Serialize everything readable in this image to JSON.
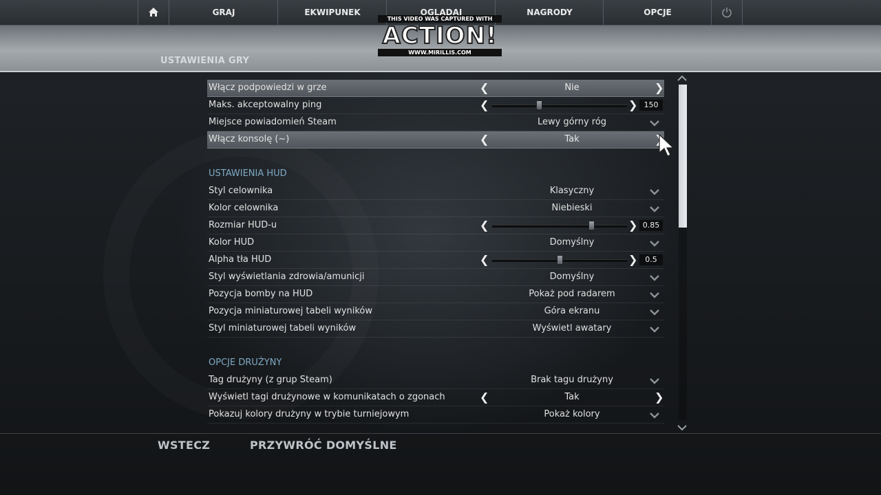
{
  "nav": {
    "items": [
      "GRAJ",
      "EKWIPUNEK",
      "OGLĄDAJ",
      "NAGRODY",
      "OPCJE"
    ]
  },
  "watermark": {
    "top": "THIS VIDEO WAS CAPTURED WITH",
    "main": "ACTION!",
    "bottom": "WWW.MIRILLIS.COM"
  },
  "header": {
    "title": "USTAWIENIA GRY"
  },
  "rows": [
    {
      "label": "Włącz podpowiedzi w grze",
      "type": "toggle",
      "value": "Nie",
      "highlight": true
    },
    {
      "label": "Maks. akceptowalny ping",
      "type": "slider",
      "value": "150",
      "level": 0.34
    },
    {
      "label": "Miejsce powiadomień Steam",
      "type": "dropdown",
      "value": "Lewy górny róg"
    },
    {
      "label": "Włącz konsolę (~)",
      "type": "toggle",
      "value": "Tak",
      "highlight": true
    }
  ],
  "hud": {
    "title": "USTAWIENIA HUD",
    "rows": [
      {
        "label": "Styl celownika",
        "type": "dropdown",
        "value": "Klasyczny"
      },
      {
        "label": "Kolor celownika",
        "type": "dropdown",
        "value": "Niebieski"
      },
      {
        "label": "Rozmiar HUD-u",
        "type": "slider",
        "value": "0.85",
        "level": 0.75
      },
      {
        "label": "Kolor HUD",
        "type": "dropdown",
        "value": "Domyślny"
      },
      {
        "label": "Alpha tła HUD",
        "type": "slider",
        "value": "0.5",
        "level": 0.5
      },
      {
        "label": "Styl wyświetlania zdrowia/amunicji",
        "type": "dropdown",
        "value": "Domyślny"
      },
      {
        "label": "Pozycja bomby na HUD",
        "type": "dropdown",
        "value": "Pokaż pod radarem"
      },
      {
        "label": "Pozycja miniaturowej tabeli wyników",
        "type": "dropdown",
        "value": "Góra ekranu"
      },
      {
        "label": "Styl miniaturowej tabeli wyników",
        "type": "dropdown",
        "value": "Wyświetl awatary"
      }
    ]
  },
  "team": {
    "title": "OPCJE DRUŻYNY",
    "rows": [
      {
        "label": "Tag drużyny (z grup Steam)",
        "type": "dropdown",
        "value": "Brak tagu drużyny"
      },
      {
        "label": "Wyświetl tagi drużynowe w komunikatach o zgonach",
        "type": "toggle",
        "value": "Tak"
      },
      {
        "label": "Pokazuj kolory drużyny w trybie turniejowym",
        "type": "dropdown",
        "value": "Pokaż kolory"
      }
    ]
  },
  "scrollbar": {
    "position": 0.0
  },
  "footer": {
    "back": "WSTECZ",
    "reset": "PRZYWRÓĆ DOMYŚLNE"
  },
  "colors": {
    "section": "#7fa9c4",
    "highlight": "#5f656b"
  }
}
